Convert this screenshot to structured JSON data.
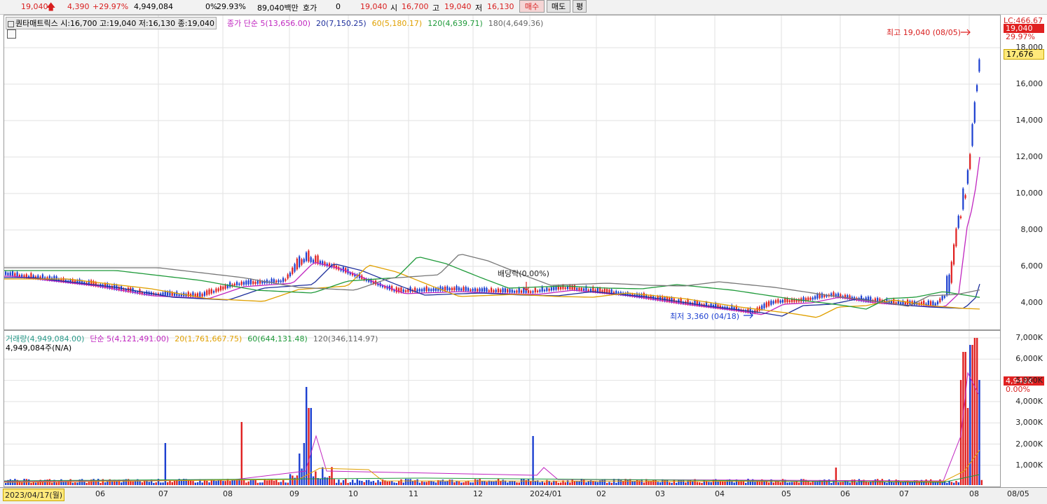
{
  "quote": {
    "price": "19,040",
    "change": "4,390",
    "change_pct": "+29.97%",
    "volume": "4,949,084",
    "ratio1": "0%",
    "ratio2": "29.93%",
    "amount": "89,040백만",
    "hoga_label": "호가",
    "hoga_value": "0",
    "hoga_price": "19,040",
    "open_label": "시",
    "open": "16,700",
    "high_label": "고",
    "high": "19,040",
    "low_label": "저",
    "low": "16,130",
    "buy_label": "매수",
    "sell_label": "매도",
    "eval_label": "평"
  },
  "price_panel": {
    "title": "퀀타매트릭스 시:16,700 고:19,040 저:16,130 종:19,040",
    "ma_legend": [
      {
        "text": "종가 단순 5(13,656.00)",
        "color": "#c026c0"
      },
      {
        "text": "20(7,150.25)",
        "color": "#1e2f9c"
      },
      {
        "text": "60(5,180.17)",
        "color": "#e0a000"
      },
      {
        "text": "120(4,639.71)",
        "color": "#1f9a3a"
      },
      {
        "text": "180(4,649.36)",
        "color": "#666666"
      }
    ],
    "y_labels": [
      "18,000",
      "16,000",
      "14,000",
      "12,000",
      "10,000",
      "8,000",
      "6,000",
      "4,000"
    ],
    "lc_label": "LC:466.67",
    "tag_price": "19,040",
    "tag_pct": "29.97%",
    "tag_ma": "17,676",
    "annotation_high": "최고 19,040 (08/05)",
    "annotation_low": "최저 3,360 (04/18)",
    "annotation_div": "배당락(0.00%)"
  },
  "volume_panel": {
    "legend": [
      {
        "text": "거래량(4,949,084.00)",
        "color": "#2a9a8a"
      },
      {
        "text": "단순 5(4,121,491.00)",
        "color": "#c026c0"
      },
      {
        "text": "20(1,761,667.75)",
        "color": "#e0a000"
      },
      {
        "text": "60(644,131.48)",
        "color": "#1f9a3a"
      },
      {
        "text": "120(346,114.97)",
        "color": "#666666"
      }
    ],
    "sub_legend": "4,949,084주(N/A)",
    "y_labels": [
      "7,000K",
      "6,000K",
      "5,000K",
      "4,000K",
      "3,000K",
      "2,000K",
      "1,000K"
    ],
    "tag_vol": "4,949K",
    "tag_pct": "0.00%"
  },
  "x_axis": {
    "start_label": "2023/04/17(월)",
    "labels": [
      "06",
      "07",
      "08",
      "09",
      "10",
      "11",
      "12",
      "2024/01",
      "02",
      "03",
      "04",
      "05",
      "06",
      "07",
      "08"
    ],
    "end_label": "08/05"
  },
  "colors": {
    "up": "#e02020",
    "down": "#1c3fd0",
    "ma5": "#c026c0",
    "ma20": "#1e2f9c",
    "ma60": "#e0a000",
    "ma120": "#1f9a3a",
    "ma180": "#777777"
  }
}
